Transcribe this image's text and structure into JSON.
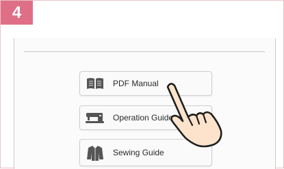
{
  "step": {
    "number": "4"
  },
  "menu": {
    "items": [
      {
        "label": "PDF Manual",
        "icon": "book-icon"
      },
      {
        "label": "Operation Guide",
        "icon": "sewing-machine-icon"
      },
      {
        "label": "Sewing Guide",
        "icon": "jacket-icon"
      }
    ]
  },
  "colors": {
    "accent": "#df6f86",
    "frame_border": "#e7c3c8",
    "icon_gray": "#555555"
  }
}
